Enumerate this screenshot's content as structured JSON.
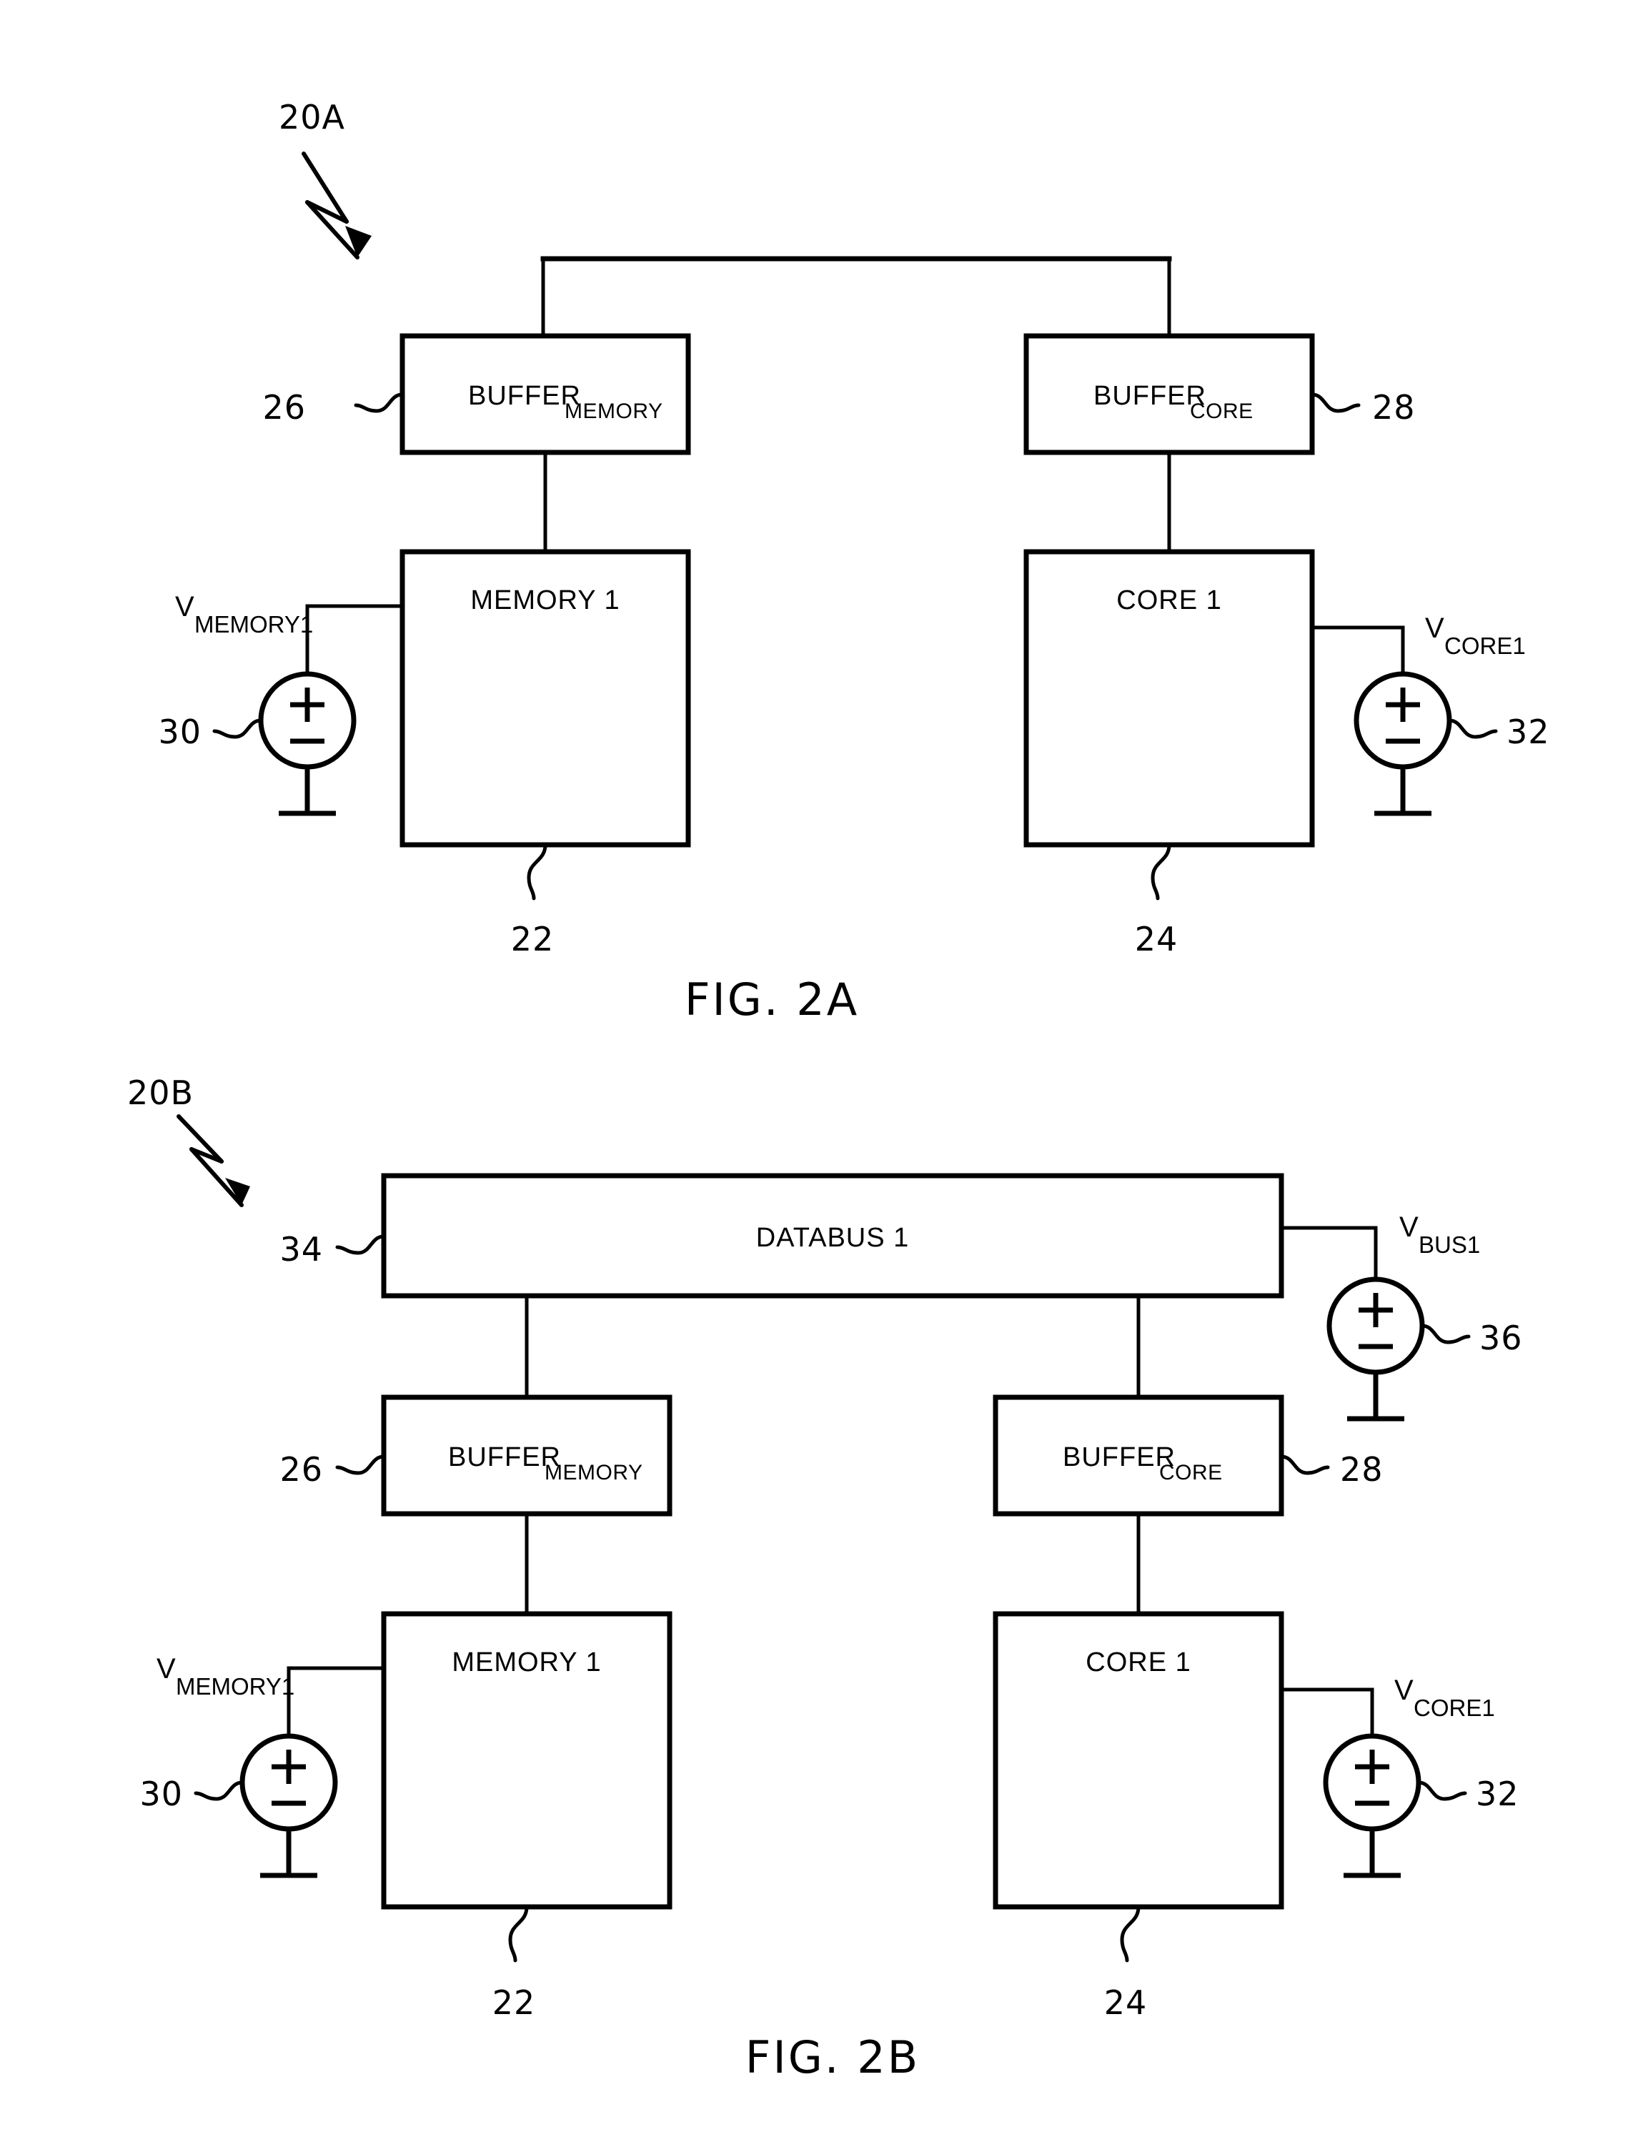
{
  "figures": [
    {
      "id": "fig-2a",
      "caption": "FIG. 2A",
      "system_ref": "20A",
      "blocks": [
        {
          "name": "buffer-memory",
          "label_main": "BUFFER",
          "label_sub": "MEMORY",
          "ref": "26"
        },
        {
          "name": "buffer-core",
          "label_main": "BUFFER",
          "label_sub": "CORE",
          "ref": "28"
        },
        {
          "name": "memory-1",
          "label_main": "MEMORY 1",
          "label_sub": "",
          "ref": "22"
        },
        {
          "name": "core-1",
          "label_main": "CORE 1",
          "label_sub": "",
          "ref": "24"
        }
      ],
      "sources": [
        {
          "name": "v-memory1",
          "v_main": "V",
          "v_sub": "MEMORY1",
          "ref": "30",
          "plus": "+",
          "minus": "−"
        },
        {
          "name": "v-core1",
          "v_main": "V",
          "v_sub": "CORE1",
          "ref": "32",
          "plus": "+",
          "minus": "−"
        }
      ]
    },
    {
      "id": "fig-2b",
      "caption": "FIG. 2B",
      "system_ref": "20B",
      "blocks": [
        {
          "name": "databus-1",
          "label_main": "DATABUS 1",
          "label_sub": "",
          "ref": "34"
        },
        {
          "name": "buffer-memory",
          "label_main": "BUFFER",
          "label_sub": "MEMORY",
          "ref": "26"
        },
        {
          "name": "buffer-core",
          "label_main": "BUFFER",
          "label_sub": "CORE",
          "ref": "28"
        },
        {
          "name": "memory-1",
          "label_main": "MEMORY 1",
          "label_sub": "",
          "ref": "22"
        },
        {
          "name": "core-1",
          "label_main": "CORE 1",
          "label_sub": "",
          "ref": "24"
        }
      ],
      "sources": [
        {
          "name": "v-bus1",
          "v_main": "V",
          "v_sub": "BUS1",
          "ref": "36",
          "plus": "+",
          "minus": "−"
        },
        {
          "name": "v-memory1",
          "v_main": "V",
          "v_sub": "MEMORY1",
          "ref": "30",
          "plus": "+",
          "minus": "−"
        },
        {
          "name": "v-core1",
          "v_main": "V",
          "v_sub": "CORE1",
          "ref": "32",
          "plus": "+",
          "minus": "−"
        }
      ]
    }
  ],
  "colors": {
    "ink": "#000000",
    "paper": "#ffffff"
  }
}
